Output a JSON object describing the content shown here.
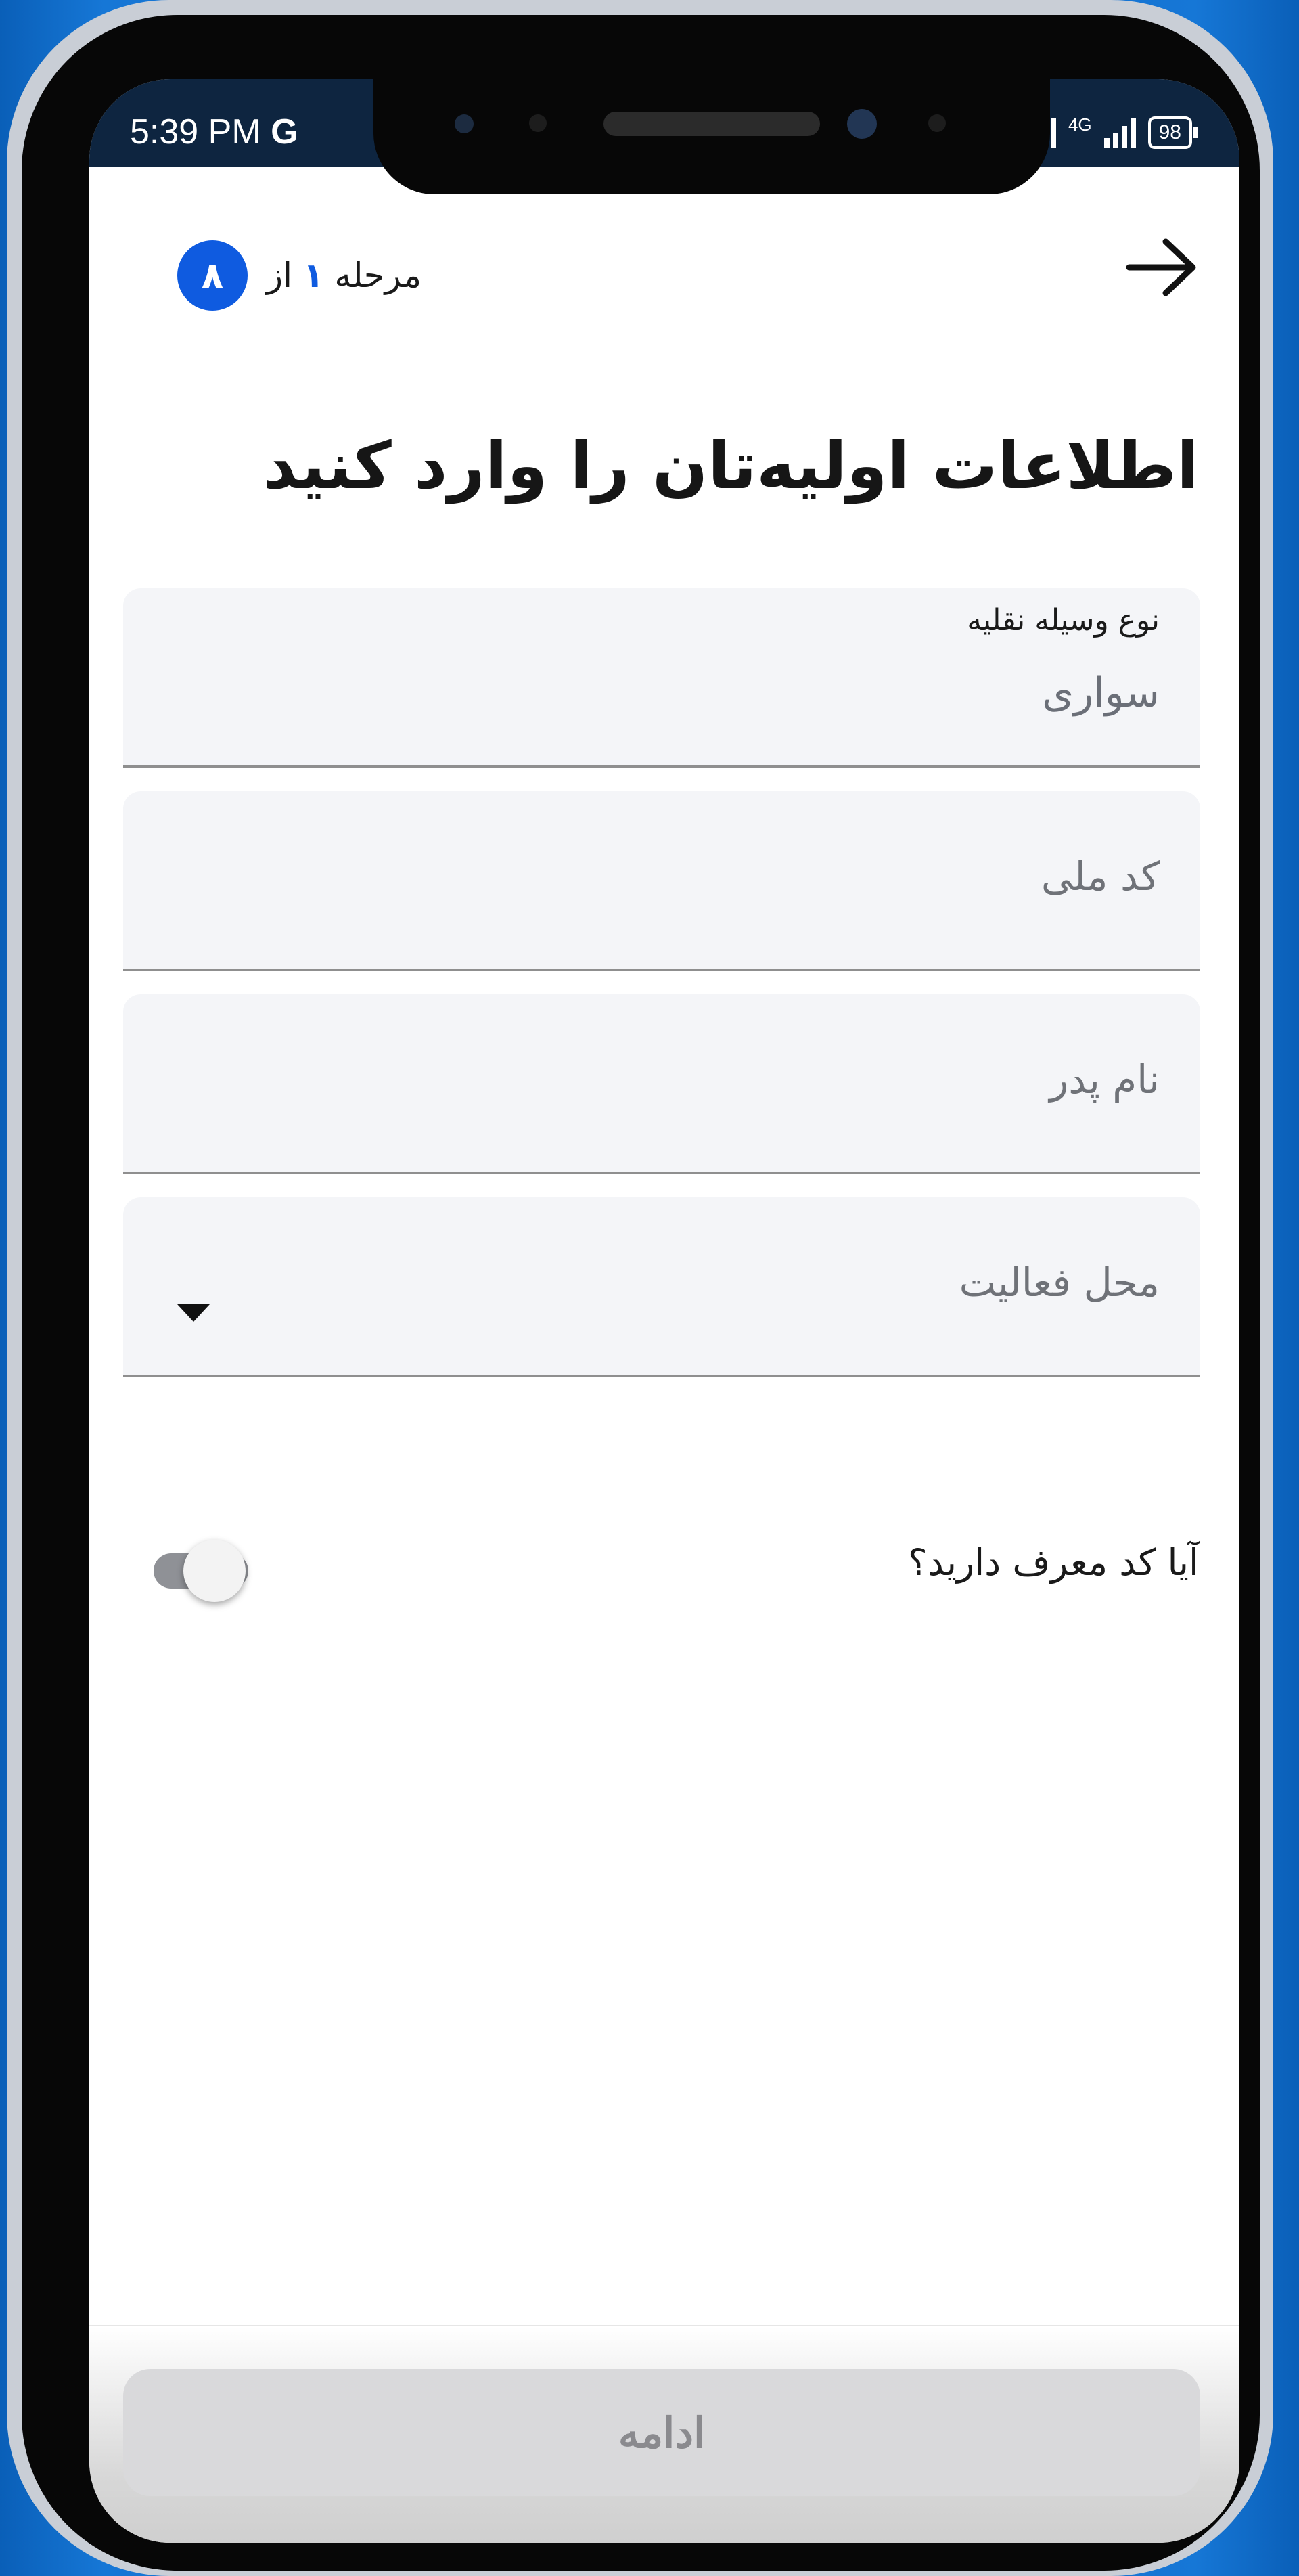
{
  "status_bar": {
    "time": "5:39 PM",
    "carrier_icon": "G",
    "network": "4G",
    "battery": "98"
  },
  "header": {
    "back_icon": "arrow-right-icon",
    "step_prefix": "مرحله",
    "step_current": "۱",
    "step_of": "از",
    "step_total": "۸"
  },
  "title": "اطلاعات اولیه‌تان را وارد کنید",
  "form": {
    "vehicle_type": {
      "label": "نوع وسیله نقلیه",
      "value": "سواری"
    },
    "national_code": {
      "placeholder": "کد ملی"
    },
    "father_name": {
      "placeholder": "نام پدر"
    },
    "activity_location": {
      "placeholder": "محل فعالیت"
    }
  },
  "referral": {
    "label": "آیا کد معرف دارید؟",
    "enabled": false
  },
  "actions": {
    "continue_label": "ادامه"
  },
  "colors": {
    "accent": "#0f5be0",
    "status_bar": "#0e2540",
    "field_bg": "#f4f5f8"
  }
}
